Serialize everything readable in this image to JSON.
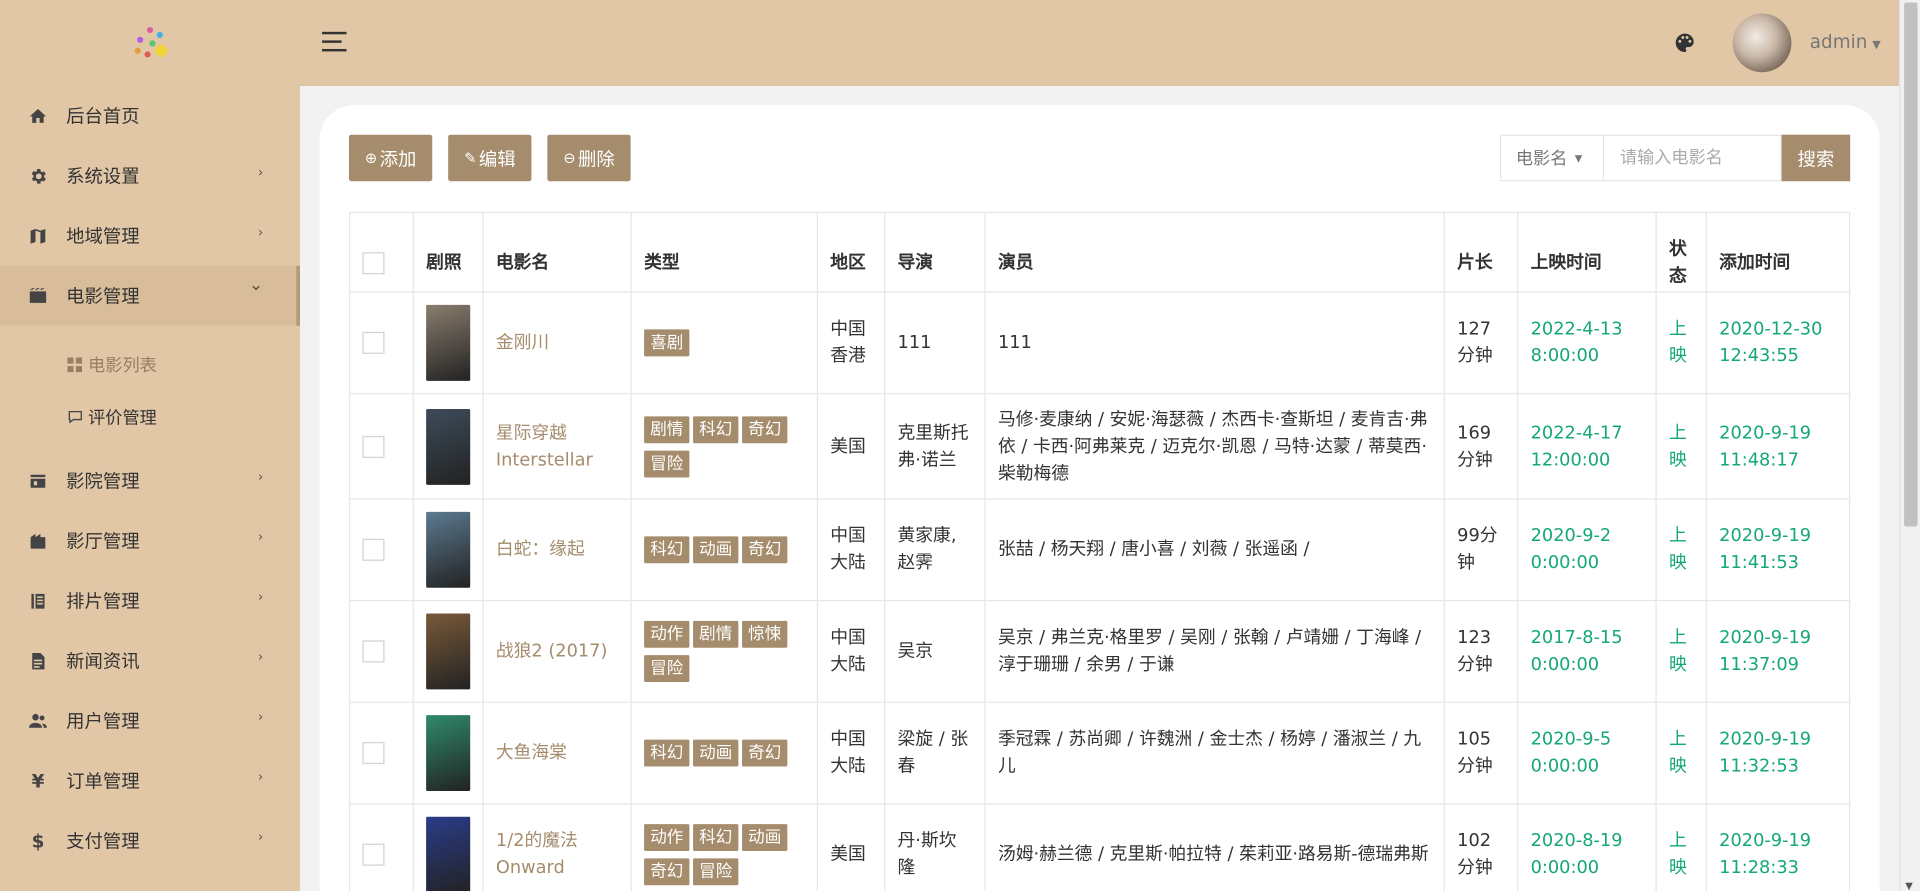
{
  "sidebar": {
    "items": [
      {
        "label": "后台首页",
        "icon": "home-icon",
        "chevron": false
      },
      {
        "label": "系统设置",
        "icon": "gear-icon",
        "chevron": true
      },
      {
        "label": "地域管理",
        "icon": "map-icon",
        "chevron": true
      },
      {
        "label": "电影管理",
        "icon": "film-icon",
        "chevron": true,
        "open": true
      },
      {
        "label": "影院管理",
        "icon": "store-icon",
        "chevron": true
      },
      {
        "label": "影厅管理",
        "icon": "building-icon",
        "chevron": true
      },
      {
        "label": "排片管理",
        "icon": "schedule-icon",
        "chevron": true
      },
      {
        "label": "新闻资讯",
        "icon": "news-icon",
        "chevron": true
      },
      {
        "label": "用户管理",
        "icon": "users-icon",
        "chevron": true
      },
      {
        "label": "订单管理",
        "icon": "yen-icon",
        "chevron": true
      },
      {
        "label": "支付管理",
        "icon": "dollar-icon",
        "chevron": true
      }
    ],
    "sub_items": [
      {
        "label": "电影列表",
        "icon": "grid-icon",
        "active": true
      },
      {
        "label": "评价管理",
        "icon": "comment-icon",
        "active": false
      }
    ]
  },
  "header": {
    "username": "admin"
  },
  "toolbar": {
    "add_label": "添加",
    "edit_label": "编辑",
    "delete_label": "删除"
  },
  "search": {
    "field_label": "电影名",
    "placeholder": "请输入电影名",
    "value": "",
    "button_label": "搜索"
  },
  "table": {
    "headers": [
      "剧照",
      "电影名",
      "类型",
      "地区",
      "导演",
      "演员",
      "片长",
      "上映时间",
      "状态",
      "添加时间"
    ],
    "rows": [
      {
        "name": "金刚川",
        "tags": [
          "喜剧"
        ],
        "region": "中国香港",
        "director": "111",
        "actors": "111",
        "duration": "127分钟",
        "release": "2022-4-13 8:00:00",
        "status": "上映",
        "added": "2020-12-30 12:43:55",
        "poster_color": "#8a7d6e"
      },
      {
        "name": "星际穿越 Interstellar",
        "tags": [
          "剧情",
          "科幻",
          "奇幻",
          "冒险"
        ],
        "region": "美国",
        "director": "克里斯托弗·诺兰",
        "actors": "马修·麦康纳 / 安妮·海瑟薇 / 杰西卡·查斯坦 / 麦肯吉·弗依 / 卡西·阿弗莱克 / 迈克尔·凯恩 / 马特·达蒙 / 蒂莫西·柴勒梅德",
        "duration": "169分钟",
        "release": "2022-4-17 12:00:00",
        "status": "上映",
        "added": "2020-9-19 11:48:17",
        "poster_color": "#3d4c5a"
      },
      {
        "name": "白蛇：缘起",
        "tags": [
          "科幻",
          "动画",
          "奇幻"
        ],
        "region": "中国大陆",
        "director": "黄家康, 赵霁",
        "actors": "张喆 / 杨天翔 / 唐小喜 / 刘薇 / 张遥函 /",
        "duration": "99分钟",
        "release": "2020-9-2 0:00:00",
        "status": "上映",
        "added": "2020-9-19 11:41:53",
        "poster_color": "#5c7a90"
      },
      {
        "name": "战狼2 (2017)",
        "tags": [
          "动作",
          "剧情",
          "惊悚",
          "冒险"
        ],
        "region": "中国大陆",
        "director": "吴京",
        "actors": "吴京 / 弗兰克·格里罗 / 吴刚 / 张翰 / 卢靖姗 / 丁海峰 / 淳于珊珊 / 余男 / 于谦",
        "duration": "123分钟",
        "release": "2017-8-15 0:00:00",
        "status": "上映",
        "added": "2020-9-19 11:37:09",
        "poster_color": "#7a5a3a"
      },
      {
        "name": "大鱼海棠",
        "tags": [
          "科幻",
          "动画",
          "奇幻"
        ],
        "region": "中国大陆",
        "director": "梁旋 / 张春",
        "actors": "季冠霖 / 苏尚卿 / 许魏洲 / 金士杰 / 杨婷 / 潘淑兰 / 九儿",
        "duration": "105分钟",
        "release": "2020-9-5 0:00:00",
        "status": "上映",
        "added": "2020-9-19 11:32:53",
        "poster_color": "#2f8a6a"
      },
      {
        "name": "1/2的魔法 Onward",
        "tags": [
          "动作",
          "科幻",
          "动画",
          "奇幻",
          "冒险"
        ],
        "region": "美国",
        "director": "丹·斯坎隆",
        "actors": "汤姆·赫兰德 / 克里斯·帕拉特 / 茱莉亚·路易斯-德瑞弗斯",
        "duration": "102分钟",
        "release": "2020-8-19 0:00:00",
        "status": "上映",
        "added": "2020-9-19 11:28:33",
        "poster_color": "#2a3c8a"
      }
    ]
  },
  "colors": {
    "sidebar_bg": "#e1c7a6",
    "accent": "#a58c6c",
    "time_green": "#14a77a"
  }
}
